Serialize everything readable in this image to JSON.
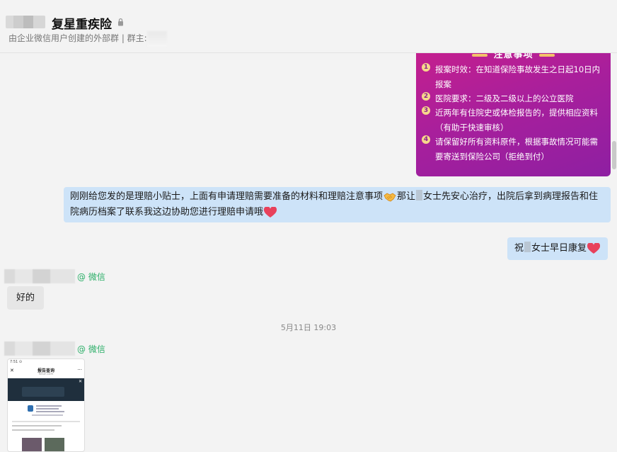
{
  "header": {
    "title": "复星重疾险",
    "subtitle": "由企业微信用户创建的外部群 | 群主:"
  },
  "poster": {
    "heading": "注意事项",
    "items": [
      {
        "num": "1",
        "text": "报案时效：在知道保险事故发生之日起10日内报案"
      },
      {
        "num": "2",
        "text": "医院要求：二级及二级以上的公立医院"
      },
      {
        "num": "3",
        "text": "近两年有住院史或体检报告的，提供相应资料（有助于快速审核）"
      },
      {
        "num": "4",
        "text": "请保留好所有资料原件，根据事故情况可能需要寄送到保险公司（拒绝到付）"
      }
    ]
  },
  "messages": {
    "m1_part1": "刚刚给您发的是理赔小贴士，上面有申请理赔需要准备的材料和理赔注意事项",
    "m1_part2": "那让",
    "m1_part3": "女士先安心治疗，出院后拿到病理报告和住院病历档案了联系我这边协助您进行理赔申请哦",
    "m2_part1": "祝",
    "m2_part2": "女士早日康复",
    "m3": "好的"
  },
  "senders": {
    "tag": "@ 微信"
  },
  "timestamp": "5月11日 19:03",
  "thumbnail": {
    "status": "7:51 ⊙",
    "title": "报告查询",
    "url": "fosun.com",
    "close": "✕",
    "more": "···"
  },
  "colors": {
    "bubble_self": "#cde3f8",
    "bubble_other": "#e6e6e6",
    "poster_bg": "#b01f96",
    "wechat_green": "#2aae67"
  }
}
